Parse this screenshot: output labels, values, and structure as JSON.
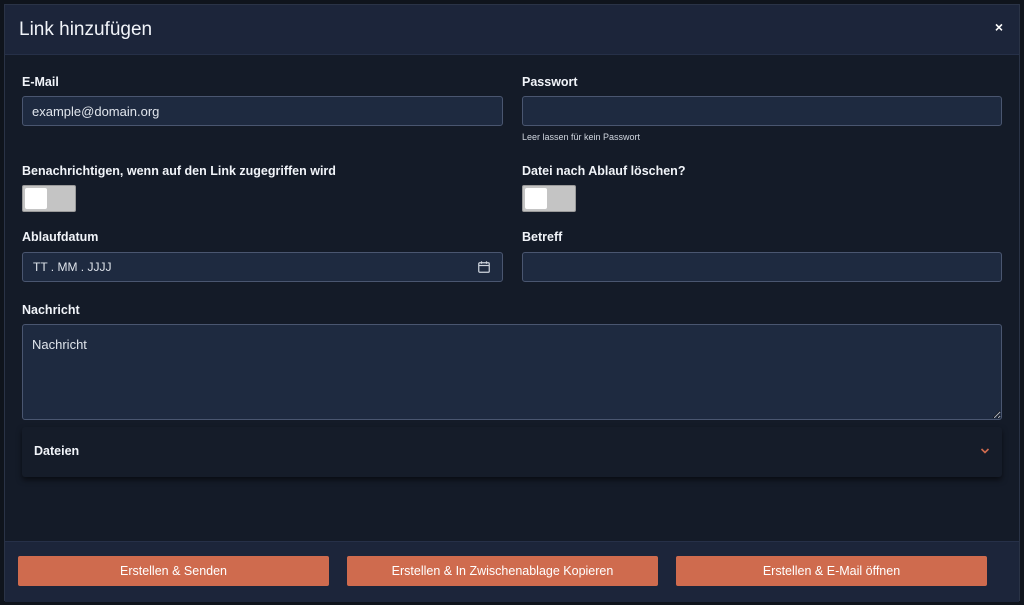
{
  "modal": {
    "title": "Link hinzufügen",
    "close_label": "×"
  },
  "form": {
    "email": {
      "label": "E-Mail",
      "placeholder": "example@domain.org",
      "value": ""
    },
    "password": {
      "label": "Passwort",
      "value": "",
      "hint": "Leer lassen für kein Passwort"
    },
    "notify": {
      "label": "Benachrichtigen, wenn auf den Link zugegriffen wird",
      "checked": false
    },
    "delete_after_expiry": {
      "label": "Datei nach Ablauf löschen?",
      "checked": false
    },
    "expiry_date": {
      "label": "Ablaufdatum",
      "placeholder": "TT . MM . JJJJ"
    },
    "subject": {
      "label": "Betreff",
      "value": ""
    },
    "message": {
      "label": "Nachricht",
      "placeholder": "Nachricht"
    },
    "files": {
      "label": "Dateien",
      "expanded": false
    }
  },
  "icons": {
    "close": "close-icon",
    "calendar": "calendar-icon",
    "expand": "chevron-down-icon"
  },
  "colors": {
    "accent": "#cf6b4e",
    "background": "#141b28",
    "header": "#1c253a",
    "input": "#1e2a40"
  },
  "footer": {
    "create_send": "Erstellen & Senden",
    "create_copy": "Erstellen & In Zwischenablage Kopieren",
    "create_mail": "Erstellen & E-Mail öffnen"
  }
}
